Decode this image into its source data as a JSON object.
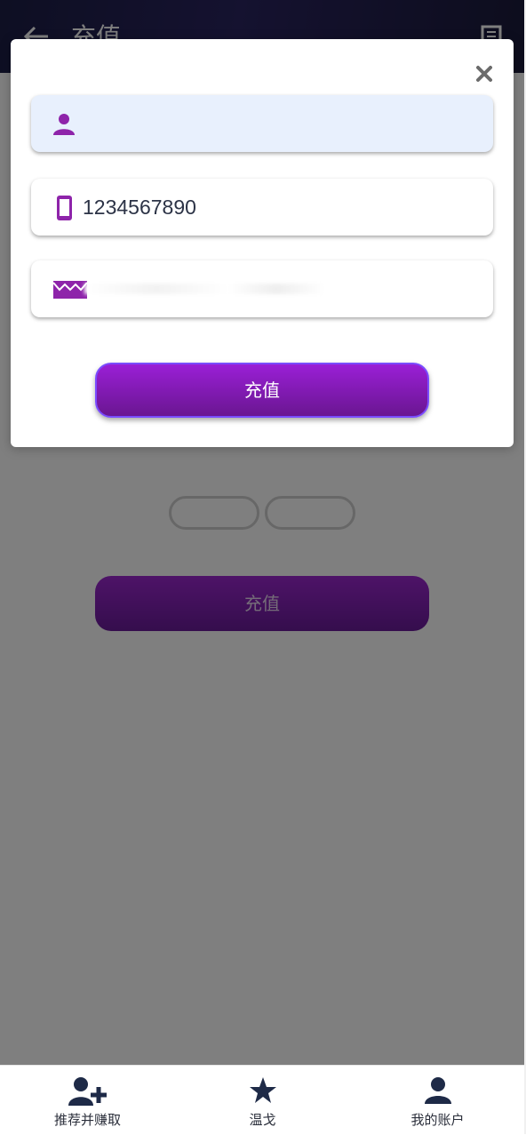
{
  "header": {
    "title": "充值"
  },
  "page": {
    "recharge_button": "充值"
  },
  "modal": {
    "fields": [
      {
        "value": "",
        "icon": "user-icon"
      },
      {
        "value": "1234567890",
        "icon": "phone-icon"
      },
      {
        "value": "",
        "icon": "email-icon"
      }
    ],
    "submit_label": "充值"
  },
  "bottom_nav": {
    "items": [
      {
        "label": "推荐并赚取",
        "icon": "add-user-icon"
      },
      {
        "label": "温戈",
        "icon": "star-icon"
      },
      {
        "label": "我的账户",
        "icon": "account-icon"
      }
    ]
  },
  "colors": {
    "accent": "#9a1fd6",
    "icon_purple": "#8e24aa",
    "nav_icon": "#1e2a47"
  }
}
